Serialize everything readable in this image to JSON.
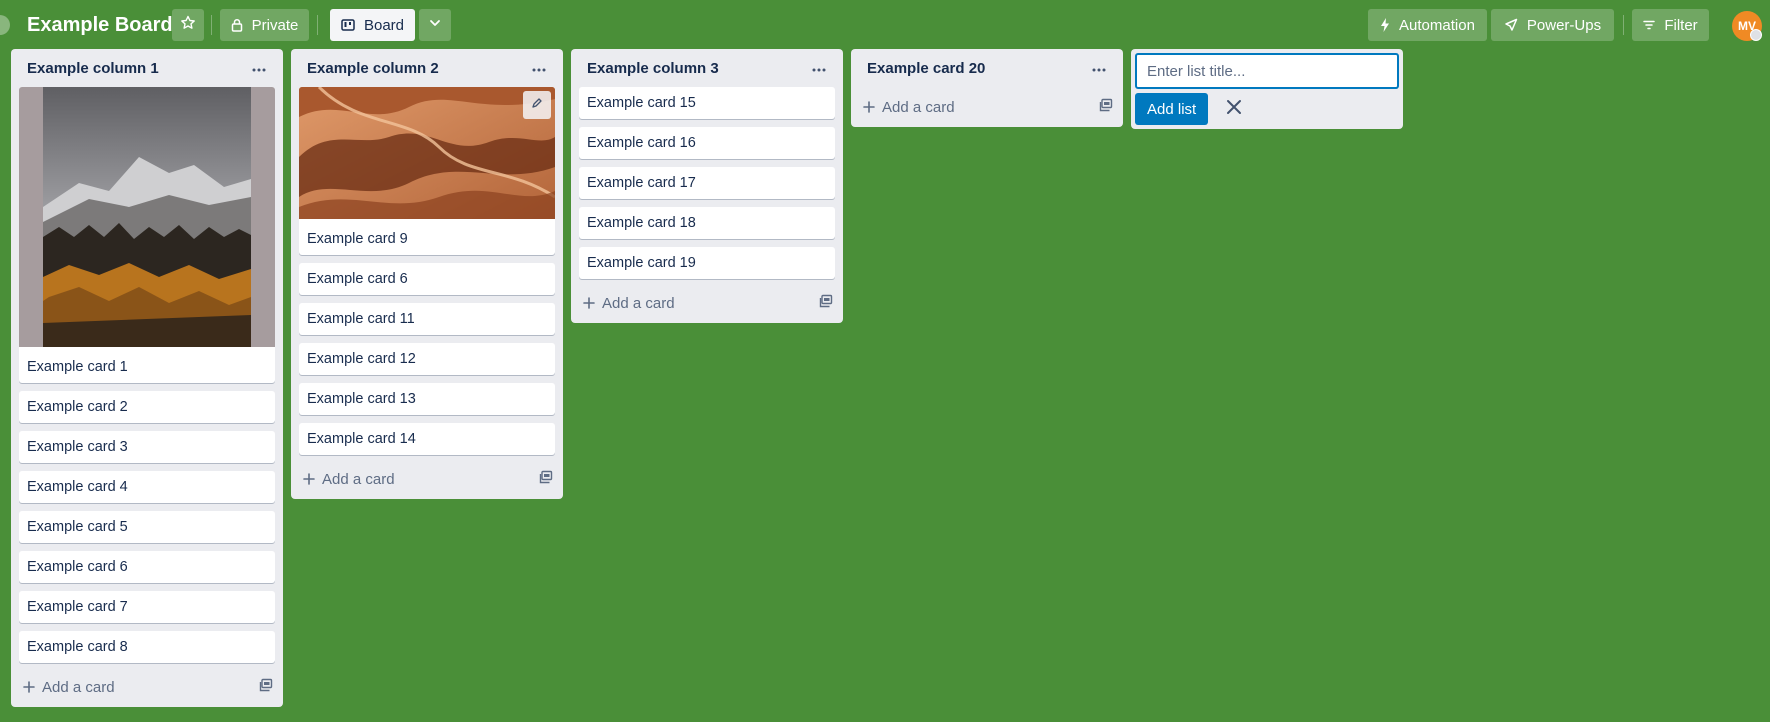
{
  "board": {
    "title": "Example Board"
  },
  "header": {
    "visibility_label": "Private",
    "view_label": "Board",
    "automation_label": "Automation",
    "powerups_label": "Power-Ups",
    "filter_label": "Filter",
    "avatar_initials": "MV"
  },
  "lists": [
    {
      "title": "Example column 1",
      "cards": [
        "Example card 1",
        "Example card 2",
        "Example card 3",
        "Example card 4",
        "Example card 5",
        "Example card 6",
        "Example card 7",
        "Example card 8"
      ],
      "add_label": "Add a card"
    },
    {
      "title": "Example column 2",
      "cards": [
        "Example card 9",
        "Example card 6",
        "Example card 11",
        "Example card 12",
        "Example card 13",
        "Example card 14"
      ],
      "add_label": "Add a card"
    },
    {
      "title": "Example column 3",
      "cards": [
        "Example card 15",
        "Example card 16",
        "Example card 17",
        "Example card 18",
        "Example card 19"
      ],
      "add_label": "Add a card"
    },
    {
      "title": "Example card 20",
      "cards": [],
      "add_label": "Add a card"
    }
  ],
  "composer": {
    "placeholder": "Enter list title...",
    "add_label": "Add list"
  },
  "colors": {
    "background": "#4a8f38",
    "list_bg": "#ebecf0",
    "primary": "#0079bf",
    "avatar": "#f08a24"
  }
}
